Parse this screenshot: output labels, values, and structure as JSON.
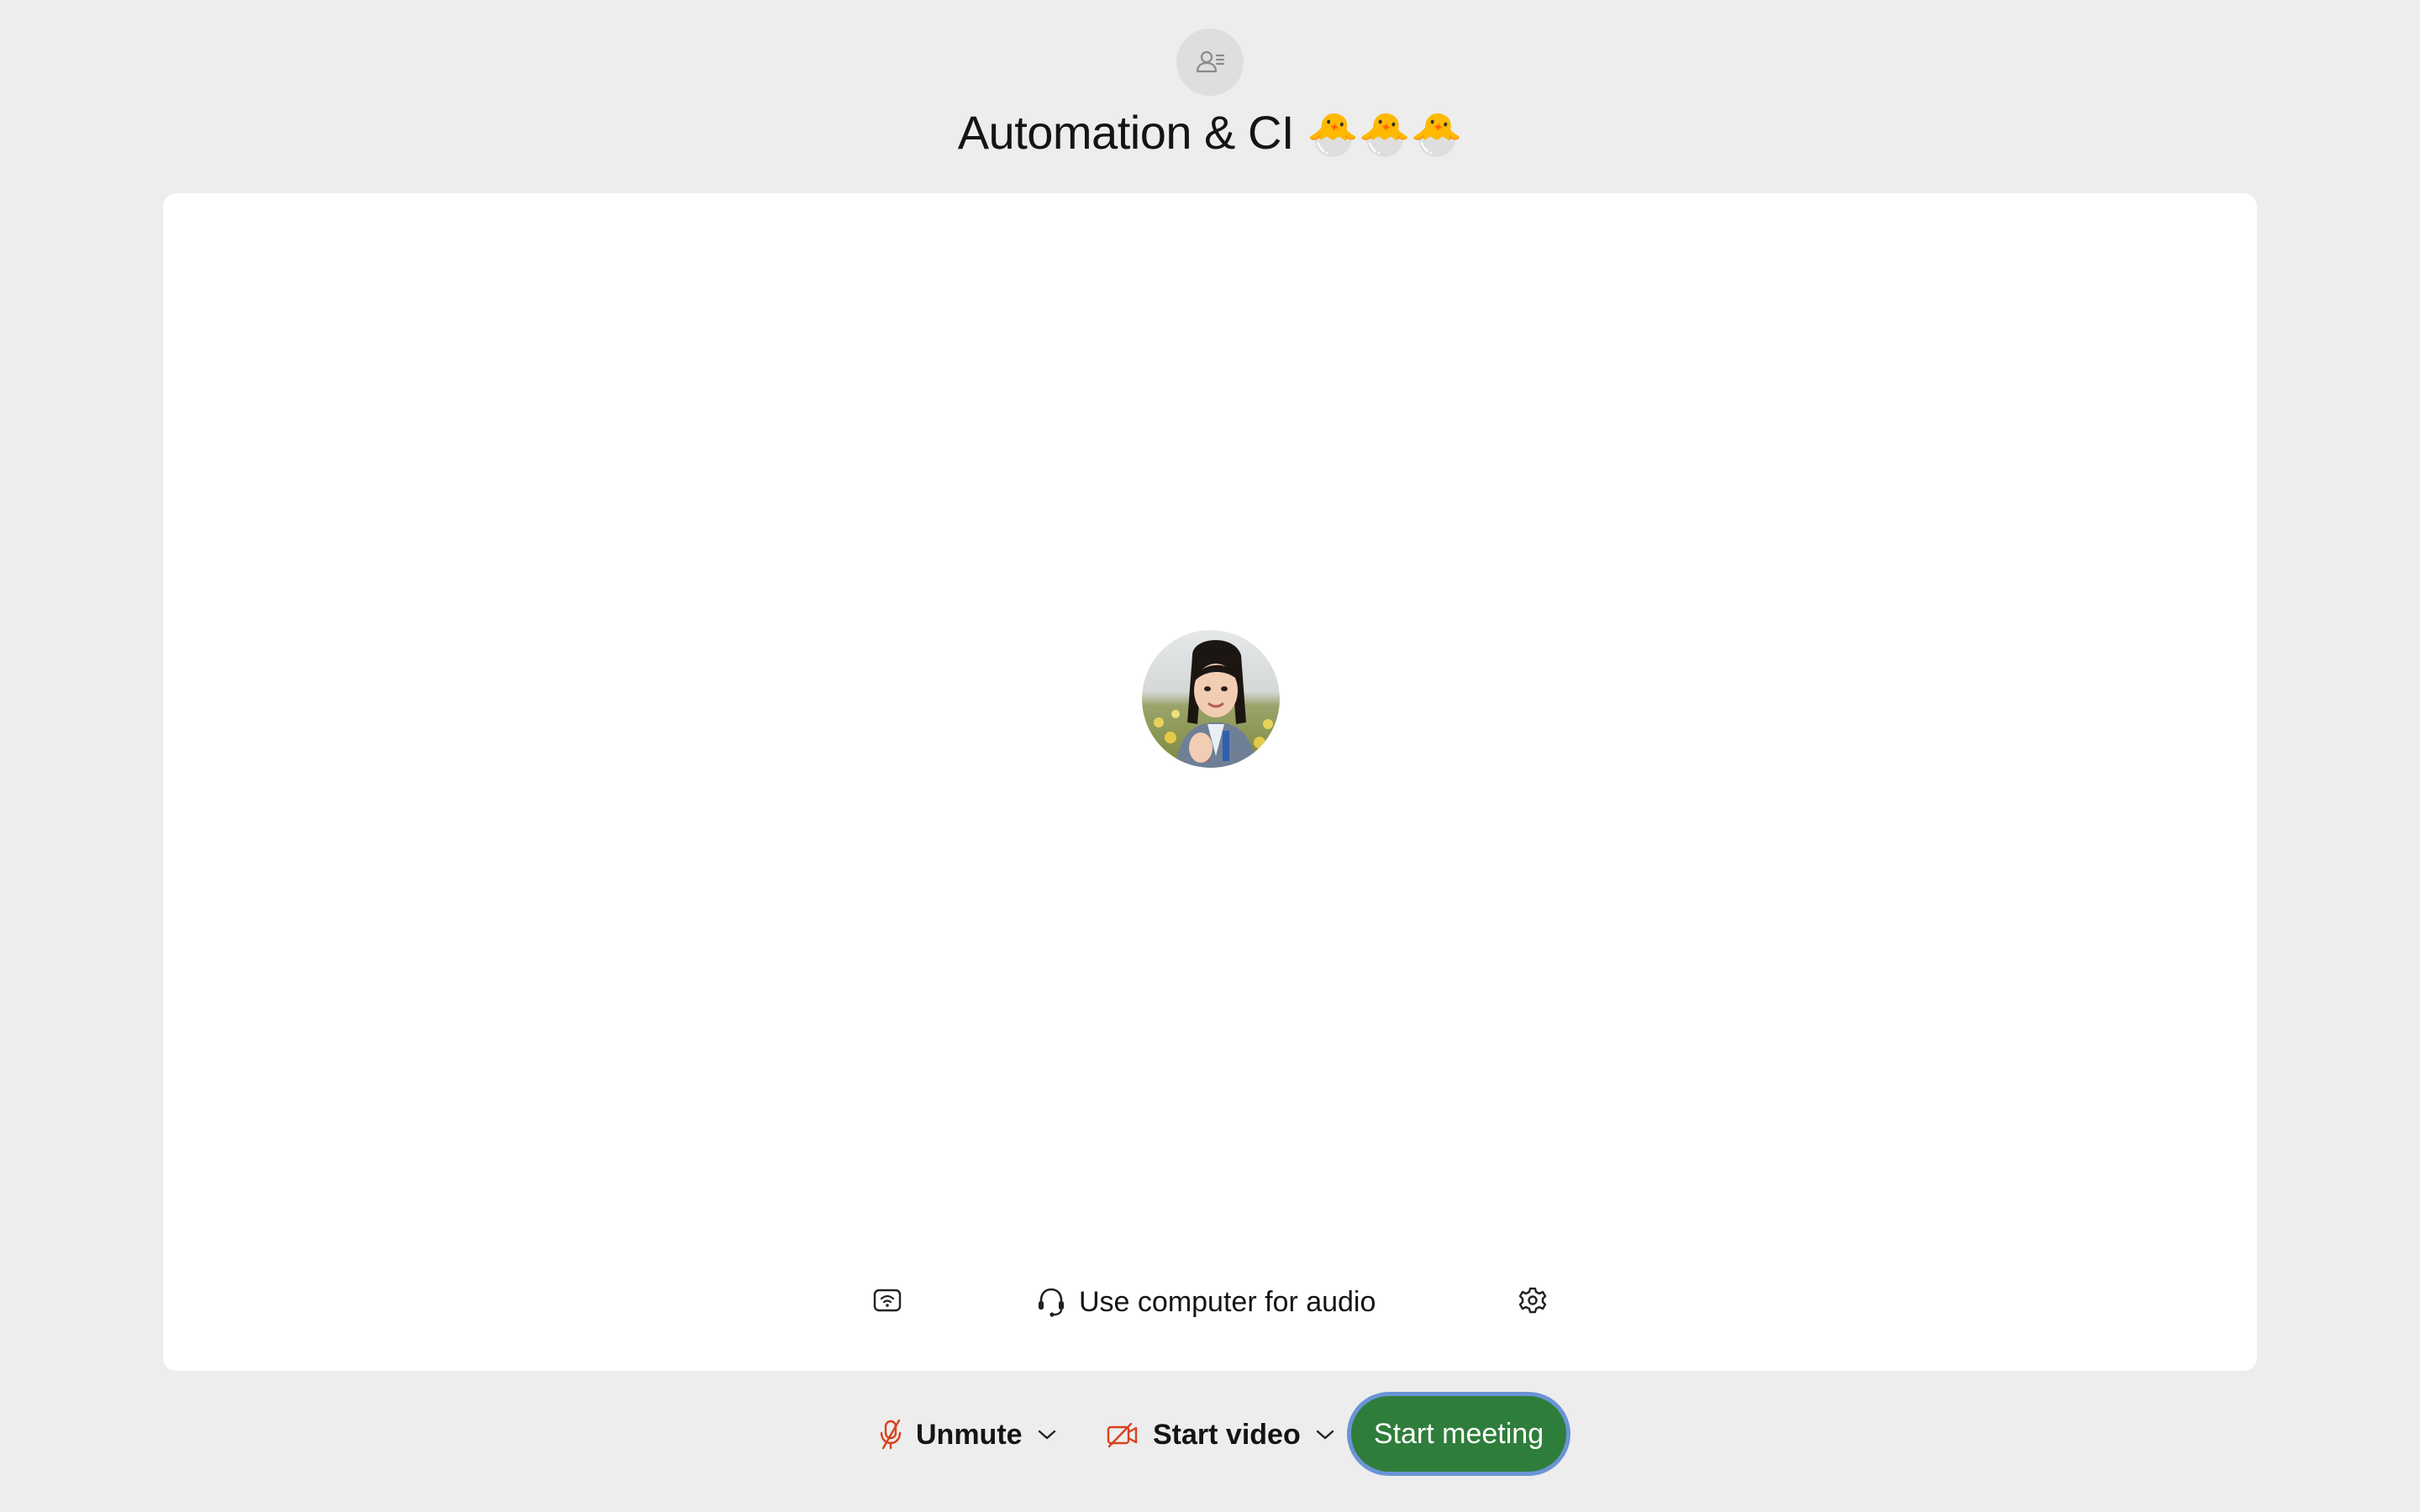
{
  "header": {
    "space_icon": "people-list-icon",
    "title": "Automation & CI",
    "title_emoji": "🐣🐣🐣"
  },
  "stage": {
    "avatar_alt": "user avatar photo",
    "toolbar": {
      "proximity_icon": "proximity-icon",
      "audio_icon": "headset-icon",
      "audio_label": "Use computer for audio",
      "settings_icon": "gear-icon"
    }
  },
  "controls": {
    "unmute": {
      "label": "Unmute",
      "icon": "microphone-muted-icon",
      "icon_color": "#d9411e"
    },
    "video": {
      "label": "Start video",
      "icon": "camera-off-icon",
      "icon_color": "#d9411e"
    },
    "start_meeting": {
      "label": "Start meeting",
      "color": "#2f7d3b",
      "focus_ring": "#6b94d6"
    }
  }
}
